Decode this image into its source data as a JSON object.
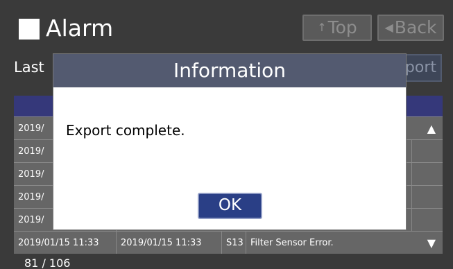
{
  "header": {
    "title": "Alarm",
    "top_label": "Top",
    "top_arrow": "↑",
    "back_label": "Back",
    "back_arrow": "◀",
    "last_label": "Last",
    "export_label": "port"
  },
  "table": {
    "rows": [
      {
        "c1": "2019/"
      },
      {
        "c1": "2019/"
      },
      {
        "c1": "2019/"
      },
      {
        "c1": "2019/"
      },
      {
        "c1": "2019/"
      },
      {
        "c1": "2019/01/15 11:33",
        "c2": "2019/01/15 11:33",
        "c3": "S13",
        "c4": "Filter Sensor Error."
      }
    ],
    "scroll_up": "▲",
    "scroll_down": "▼"
  },
  "pager": "81 / 106",
  "dialog": {
    "title": "Information",
    "message": "Export complete.",
    "ok_label": "OK"
  },
  "colors": {
    "background": "#3a3a3a",
    "table_header": "#35387a",
    "row": "#666666",
    "dialog_header": "#535a70",
    "ok_button": "#2a3f86"
  }
}
